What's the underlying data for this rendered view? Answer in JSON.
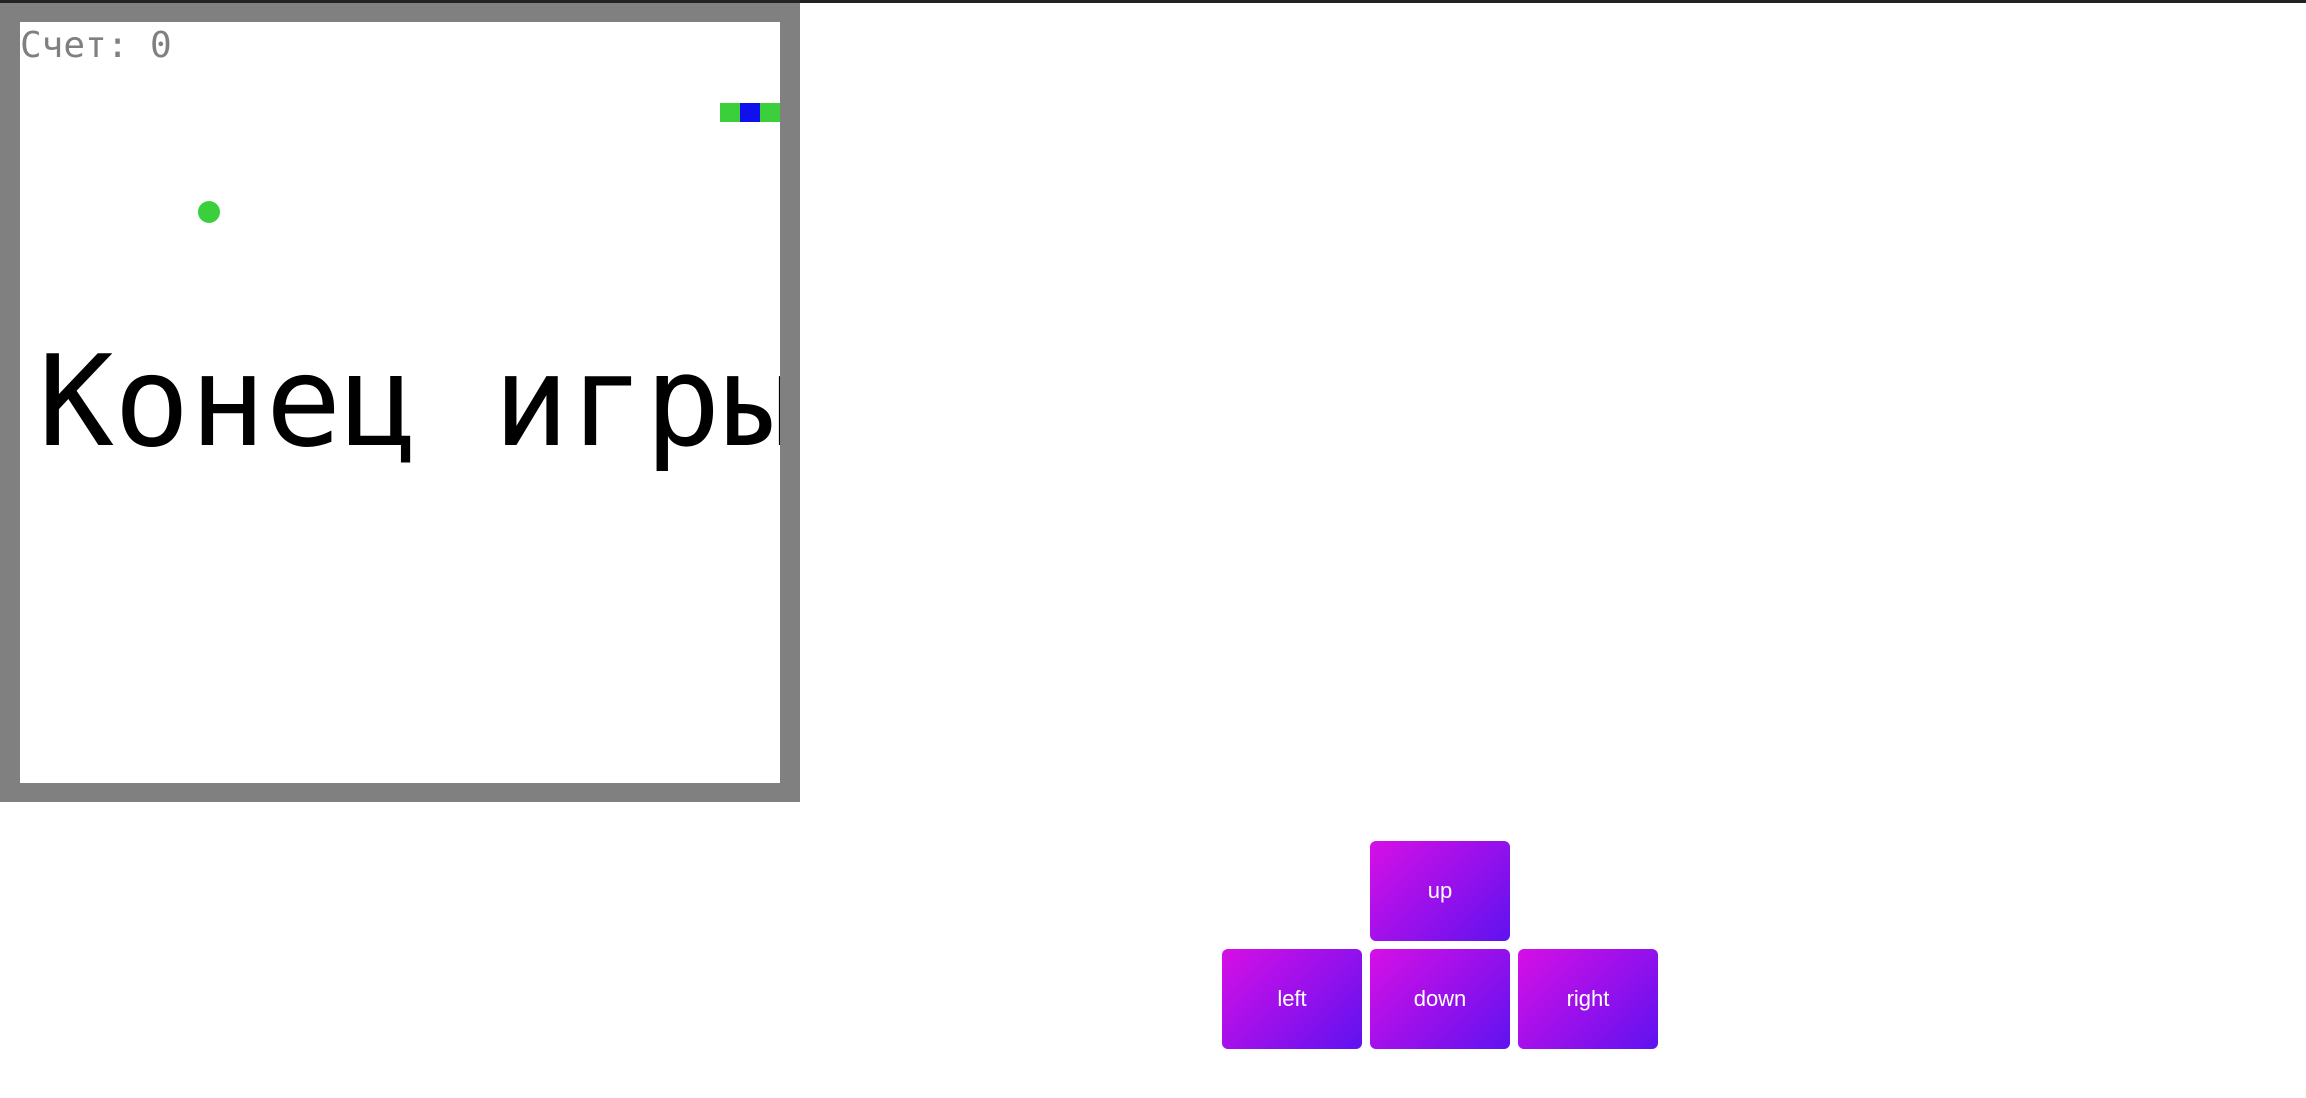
{
  "game": {
    "score_text": "Счет: 0",
    "game_over_text": "Конец игры"
  },
  "controls": {
    "up_label": "up",
    "left_label": "left",
    "down_label": "down",
    "right_label": "right"
  },
  "colors": {
    "frame": "#808080",
    "snake_body": "#3ccf3c",
    "snake_head": "#1010ee",
    "food": "#3ccf3c",
    "button_gradient_start": "#d70fe6",
    "button_gradient_end": "#5e12f0"
  }
}
